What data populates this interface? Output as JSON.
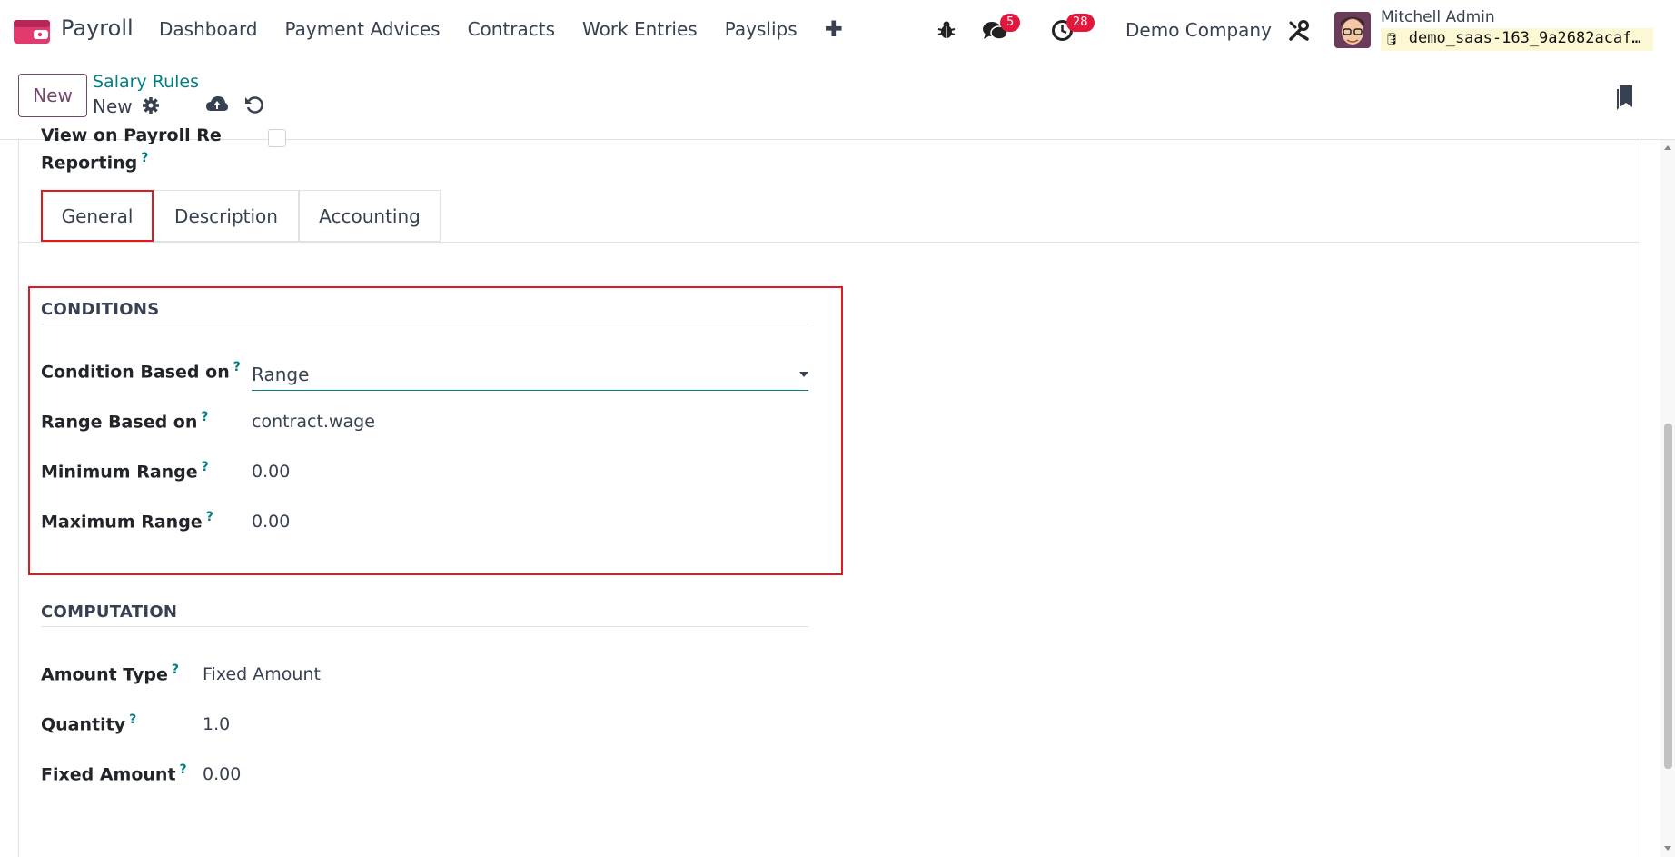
{
  "navbar": {
    "app_name": "Payroll",
    "menu": [
      "Dashboard",
      "Payment Advices",
      "Contracts",
      "Work Entries",
      "Payslips"
    ],
    "messages_badge": "5",
    "activities_badge": "28",
    "company": "Demo Company",
    "user_name": "Mitchell Admin",
    "database": "demo_saas-163_9a2682acaf…"
  },
  "control_panel": {
    "new_label": "New",
    "breadcrumb_parent": "Salary Rules",
    "breadcrumb_current": "New"
  },
  "form": {
    "partial_field_label": "View on Payroll Reporting",
    "reporting_label": "Reporting",
    "tabs": [
      "General",
      "Description",
      "Accounting"
    ],
    "active_tab": "General",
    "conditions": {
      "title": "CONDITIONS",
      "condition_based_on_label": "Condition Based on",
      "condition_based_on_value": "Range",
      "range_based_on_label": "Range Based on",
      "range_based_on_value": "contract.wage",
      "min_range_label": "Minimum Range",
      "min_range_value": "0.00",
      "max_range_label": "Maximum Range",
      "max_range_value": "0.00"
    },
    "computation": {
      "title": "COMPUTATION",
      "amount_type_label": "Amount Type",
      "amount_type_value": "Fixed Amount",
      "quantity_label": "Quantity",
      "quantity_value": "1.0",
      "fixed_amount_label": "Fixed Amount",
      "fixed_amount_value": "0.00"
    },
    "help_mark": "?"
  },
  "colors": {
    "accent": "#71486a",
    "link": "#017e84",
    "highlight": "#e0181f",
    "badge": "#e3173c"
  }
}
